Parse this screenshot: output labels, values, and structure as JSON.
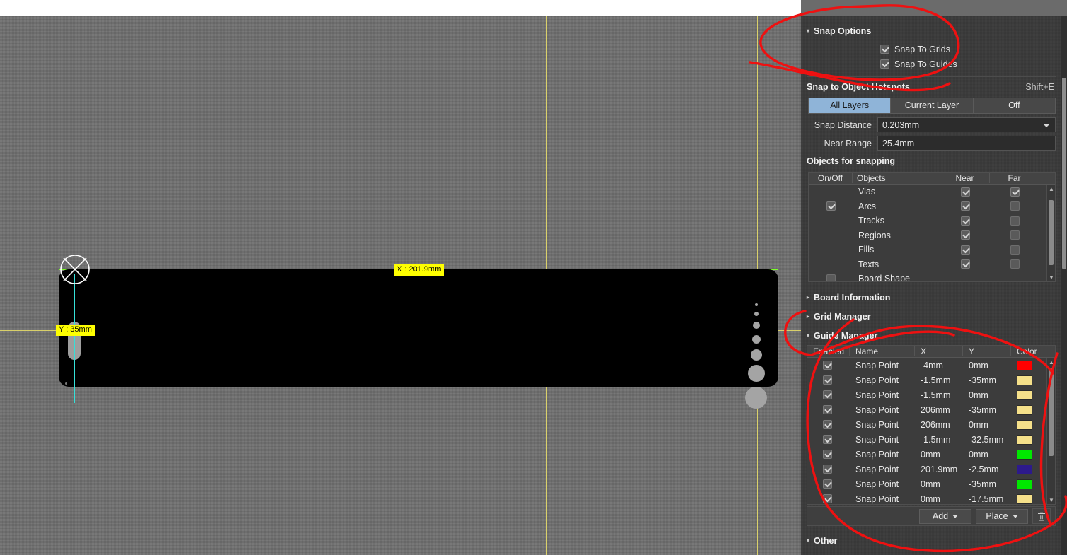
{
  "canvas": {
    "coord_tags": [
      {
        "name": "x-coordinate-tag",
        "text": "X : 201.9mm"
      },
      {
        "name": "y-coordinate-tag",
        "text": "Y : 35mm"
      }
    ]
  },
  "panel": {
    "snap_options": {
      "title": "Snap Options",
      "checkboxes": [
        {
          "label": "Snap To Grids",
          "checked": true
        },
        {
          "label": "Snap To Guides",
          "checked": true
        }
      ],
      "hotspots_title": "Snap to Object Hotspots",
      "hotspots_shortcut": "Shift+E",
      "segments": [
        {
          "label": "All Layers",
          "active": true
        },
        {
          "label": "Current Layer",
          "active": false
        },
        {
          "label": "Off",
          "active": false
        }
      ],
      "snap_distance_label": "Snap Distance",
      "snap_distance_value": "0.203mm",
      "near_range_label": "Near Range",
      "near_range_value": "25.4mm",
      "objects_title": "Objects for snapping",
      "objects_columns": [
        "On/Off",
        "Objects",
        "Near",
        "Far"
      ],
      "objects_rows": [
        {
          "onoff": false,
          "onoff_visible": false,
          "name": "Vias",
          "near": true,
          "far": true
        },
        {
          "onoff": true,
          "onoff_visible": true,
          "name": "Arcs",
          "near": true,
          "far": false
        },
        {
          "onoff": false,
          "onoff_visible": false,
          "name": "Tracks",
          "near": true,
          "far": false
        },
        {
          "onoff": false,
          "onoff_visible": false,
          "name": "Regions",
          "near": true,
          "far": false
        },
        {
          "onoff": false,
          "onoff_visible": false,
          "name": "Fills",
          "near": true,
          "far": false
        },
        {
          "onoff": false,
          "onoff_visible": false,
          "name": "Texts",
          "near": true,
          "far": false
        },
        {
          "onoff": false,
          "onoff_visible": true,
          "name": "Board Shape",
          "near": false,
          "far": false
        }
      ]
    },
    "board_information": {
      "title": "Board Information",
      "expanded": false
    },
    "grid_manager": {
      "title": "Grid Manager",
      "expanded": false
    },
    "guide_manager": {
      "title": "Guide Manager",
      "expanded": true,
      "columns": [
        "Enabled",
        "Name",
        "X",
        "Y",
        "Color"
      ],
      "rows": [
        {
          "enabled": true,
          "name": "Snap Point",
          "x": "-4mm",
          "y": "0mm",
          "color": "#ff0000"
        },
        {
          "enabled": true,
          "name": "Snap Point",
          "x": "-1.5mm",
          "y": "-35mm",
          "color": "#f5e08a"
        },
        {
          "enabled": true,
          "name": "Snap Point",
          "x": "-1.5mm",
          "y": "0mm",
          "color": "#f5e08a"
        },
        {
          "enabled": true,
          "name": "Snap Point",
          "x": "206mm",
          "y": "-35mm",
          "color": "#f5e08a"
        },
        {
          "enabled": true,
          "name": "Snap Point",
          "x": "206mm",
          "y": "0mm",
          "color": "#f5e08a"
        },
        {
          "enabled": true,
          "name": "Snap Point",
          "x": "-1.5mm",
          "y": "-32.5mm",
          "color": "#f5e08a"
        },
        {
          "enabled": true,
          "name": "Snap Point",
          "x": "0mm",
          "y": "0mm",
          "color": "#00e800"
        },
        {
          "enabled": true,
          "name": "Snap Point",
          "x": "201.9mm",
          "y": "-2.5mm",
          "color": "#2d1a8c"
        },
        {
          "enabled": true,
          "name": "Snap Point",
          "x": "0mm",
          "y": "-35mm",
          "color": "#00e800"
        },
        {
          "enabled": true,
          "name": "Snap Point",
          "x": "0mm",
          "y": "-17.5mm",
          "color": "#f5e08a"
        }
      ],
      "buttons": [
        {
          "name": "add-button",
          "label": "Add"
        },
        {
          "name": "place-button",
          "label": "Place"
        }
      ],
      "delete_icon": "trash-icon"
    },
    "other": {
      "title": "Other",
      "expanded": true
    }
  },
  "colors": {
    "accent_selected": "#8fb4d8",
    "guide_line": "#d9d06a",
    "board": "#000000",
    "board_outline_top": "#7dff2a",
    "coord_tag_bg": "#ffff00",
    "annotation": "#ee1111",
    "panel_bg": "#3a3a3a",
    "canvas_bg": "#6e6e6e"
  }
}
